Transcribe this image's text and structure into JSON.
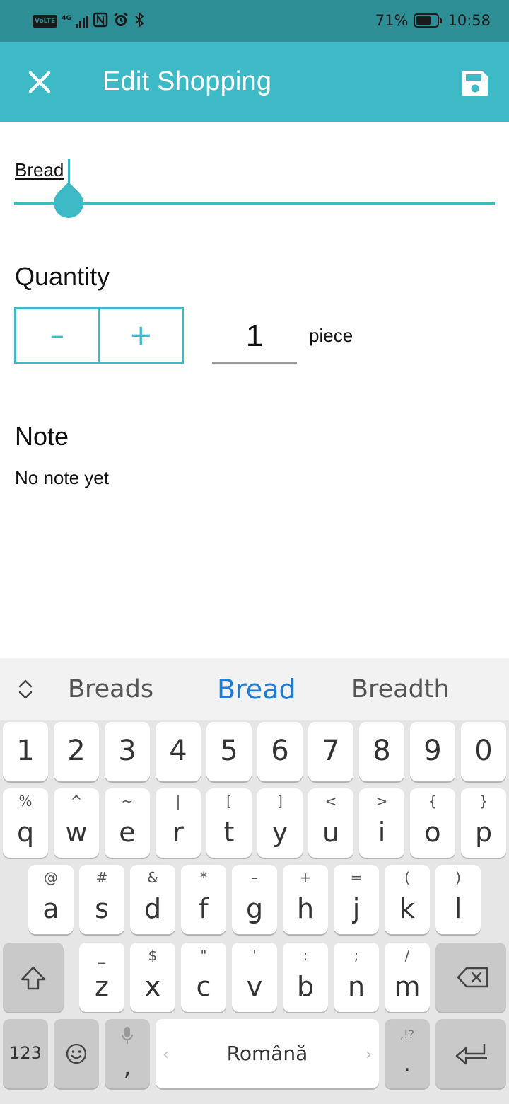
{
  "status_bar": {
    "volte": "VoLTE",
    "network": "4G",
    "battery_percent": "71%",
    "battery_level": 0.71,
    "time": "10:58",
    "icons": [
      "nfc-icon",
      "alarm-icon",
      "bluetooth-icon"
    ]
  },
  "app_bar": {
    "title": "Edit Shopping",
    "close_icon": "close-icon",
    "save_icon": "save-icon",
    "color": "#3dbac6"
  },
  "item": {
    "name": "Bread"
  },
  "quantity": {
    "label": "Quantity",
    "decrement": "–",
    "increment": "+",
    "value": "1",
    "unit": "piece"
  },
  "note": {
    "label": "Note",
    "text": "No note yet"
  },
  "keyboard": {
    "suggestions": [
      "Breads",
      "Bread",
      "Breadth"
    ],
    "selected_suggestion": "Bread",
    "number_row": [
      "1",
      "2",
      "3",
      "4",
      "5",
      "6",
      "7",
      "8",
      "9",
      "0"
    ],
    "row1": [
      {
        "k": "q",
        "s": "%"
      },
      {
        "k": "w",
        "s": "^"
      },
      {
        "k": "e",
        "s": "~"
      },
      {
        "k": "r",
        "s": "|"
      },
      {
        "k": "t",
        "s": "["
      },
      {
        "k": "y",
        "s": "]"
      },
      {
        "k": "u",
        "s": "<"
      },
      {
        "k": "i",
        "s": ">"
      },
      {
        "k": "o",
        "s": "{"
      },
      {
        "k": "p",
        "s": "}"
      }
    ],
    "row2": [
      {
        "k": "a",
        "s": "@"
      },
      {
        "k": "s",
        "s": "#"
      },
      {
        "k": "d",
        "s": "&"
      },
      {
        "k": "f",
        "s": "*"
      },
      {
        "k": "g",
        "s": "–"
      },
      {
        "k": "h",
        "s": "+"
      },
      {
        "k": "j",
        "s": "="
      },
      {
        "k": "k",
        "s": "("
      },
      {
        "k": "l",
        "s": ")"
      }
    ],
    "row3": [
      {
        "k": "z",
        "s": "_"
      },
      {
        "k": "x",
        "s": "$"
      },
      {
        "k": "c",
        "s": "\""
      },
      {
        "k": "v",
        "s": "'"
      },
      {
        "k": "b",
        "s": ":"
      },
      {
        "k": "n",
        "s": ";"
      },
      {
        "k": "m",
        "s": "/"
      }
    ],
    "symbols_key": "123",
    "comma_key": ",",
    "space_label": "Română",
    "period_key": ".",
    "period_sub": ",!?"
  }
}
